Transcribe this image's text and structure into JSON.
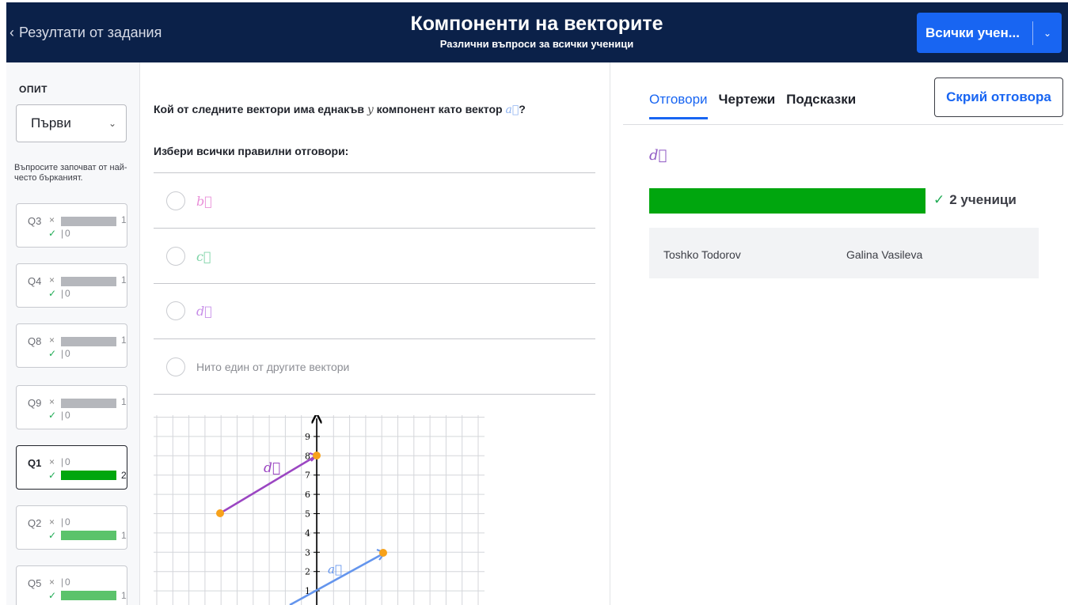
{
  "header": {
    "back_label": "Резултати от задания",
    "title": "Компоненти на векторите",
    "subtitle": "Различни въпроси за всички ученици",
    "students_button": "Всички учен...",
    "colors": {
      "background": "#0b2149",
      "accent": "#1865f2"
    }
  },
  "sidebar": {
    "attempt_label": "ОПИТ",
    "attempt_value": "Първи",
    "sort_note": "Въпросите започват от най-често бърканият.",
    "questions": [
      {
        "id": "Q3",
        "wrong": 1,
        "right": 0
      },
      {
        "id": "Q4",
        "wrong": 1,
        "right": 0
      },
      {
        "id": "Q8",
        "wrong": 1,
        "right": 0
      },
      {
        "id": "Q9",
        "wrong": 1,
        "right": 0
      },
      {
        "id": "Q1",
        "wrong": 0,
        "right": 2,
        "active": true
      },
      {
        "id": "Q2",
        "wrong": 0,
        "right": 1
      },
      {
        "id": "Q5",
        "wrong": 0,
        "right": 1
      }
    ]
  },
  "question": {
    "text_before": "Кой от следните вектори има еднакъв ",
    "component_var": "y",
    "text_middle": " компонент като вектор ",
    "vector_var": "a⃗",
    "text_after": "?",
    "instruction": "Избери всички правилни отговори:",
    "choices": [
      {
        "label": "b⃗",
        "color": "#e98fd8"
      },
      {
        "label": "c⃗",
        "color": "#7fd4a8"
      },
      {
        "label": "d⃗",
        "color": "#c78ee8"
      },
      {
        "label": "Нито един от другите вектори",
        "color": "#8c8e94"
      }
    ]
  },
  "graph": {
    "y_ticks": [
      "1",
      "2",
      "3",
      "4",
      "5",
      "6",
      "7",
      "8",
      "9"
    ],
    "vectors": [
      {
        "name": "d⃗",
        "color": "#9b46c2",
        "label": "d⃗"
      },
      {
        "name": "a⃗",
        "color": "#6495ed",
        "label": "a⃗"
      }
    ],
    "point_color": "#f7a21b"
  },
  "answers_panel": {
    "tabs": [
      "Отговори",
      "Чертежи",
      "Подсказки"
    ],
    "active_tab": "Отговори",
    "hide_button": "Скрий отговора",
    "answer_vector": "d⃗",
    "answer_count": "2 ученици",
    "bar_color": "#00a60e",
    "students": [
      "Toshko Todorov",
      "Galina Vasileva"
    ]
  }
}
